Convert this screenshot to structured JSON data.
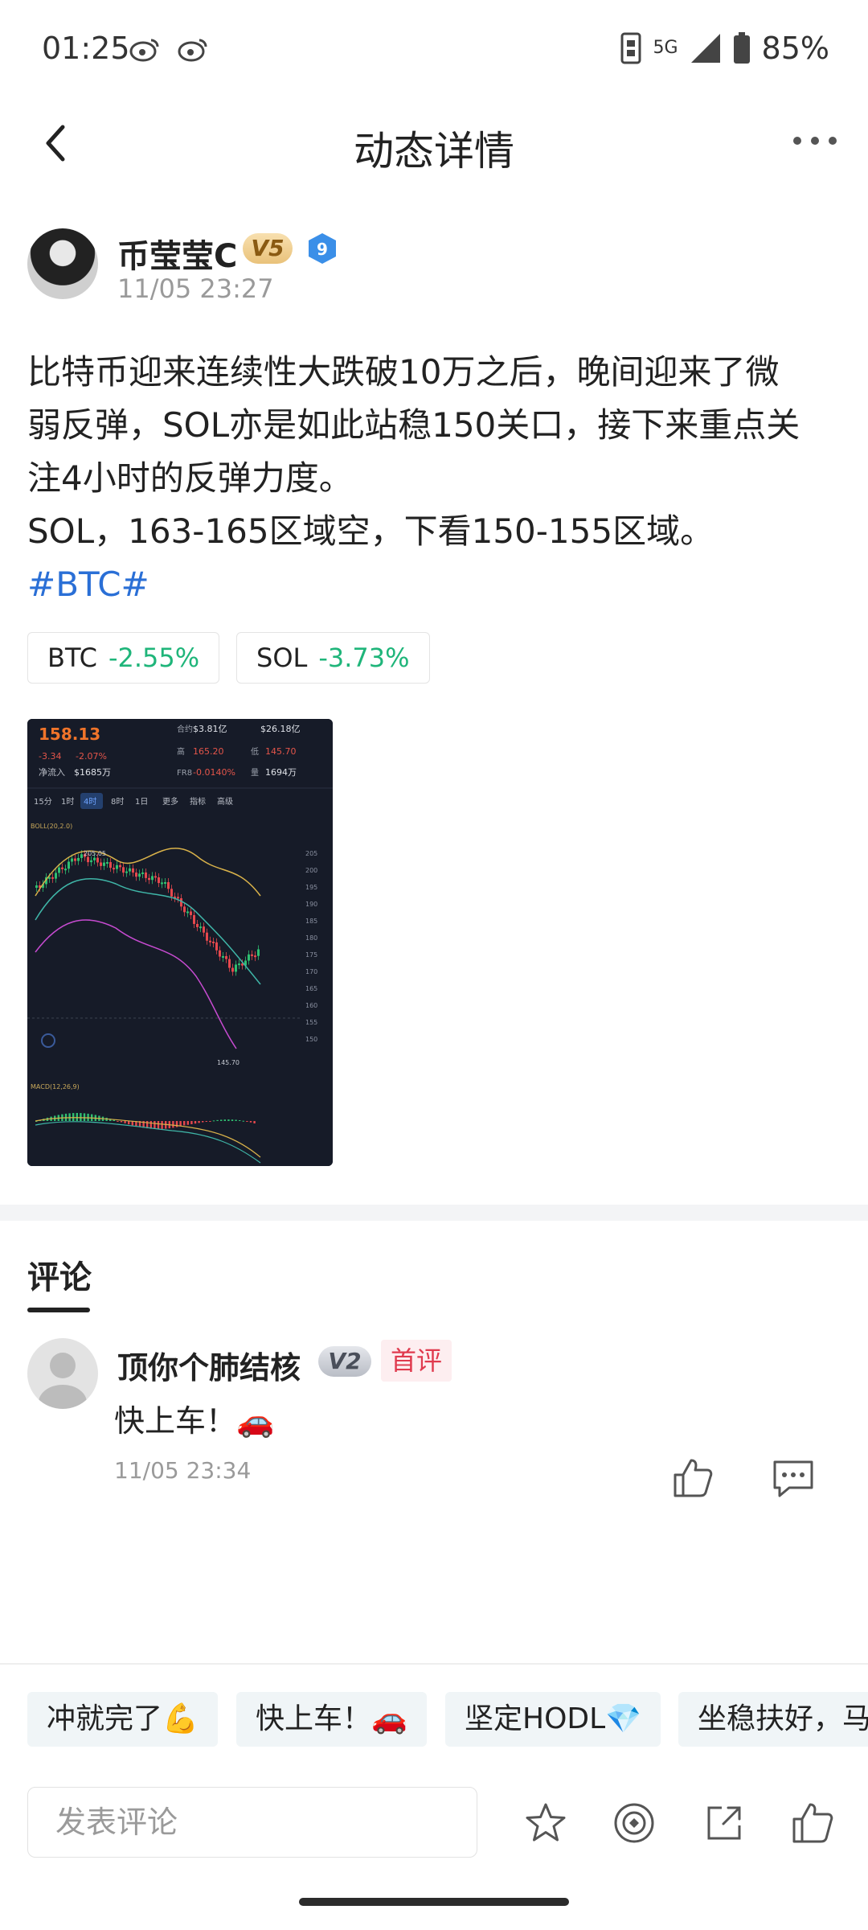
{
  "status_bar": {
    "time": "01:25",
    "battery": "85%",
    "network": "5G"
  },
  "header": {
    "title": "动态详情"
  },
  "post": {
    "author": "币莹莹C",
    "author_badge": "V5",
    "level_badge": "9",
    "time": "11/05 23:27",
    "text": "比特币迎来连续性大跌破10万之后，晚间迎来了微\n弱反弹，SOL亦是如此站稳150关口，接下来重点关\n注4小时的反弹力度。\nSOL，163-165区域空，下看150-155区域。",
    "hashtag": "#BTC#",
    "tickers": [
      {
        "symbol": "BTC",
        "change": "-2.55%"
      },
      {
        "symbol": "SOL",
        "change": "-3.73%"
      }
    ]
  },
  "chart_image": {
    "price": "158.13",
    "delta": "-3.34",
    "delta_pct": "-2.07%",
    "net_inflow_label": "净流入",
    "net_inflow": "$1685万",
    "turnover_label": "合约",
    "turnover": "$3.81亿",
    "volume": "$26.18亿",
    "high_label": "高",
    "high": "165.20",
    "low_label": "低",
    "low": "145.70",
    "funding_label": "FR8",
    "funding": "-0.0140%",
    "qty_label": "量",
    "qty": "1694万",
    "intervals": [
      "15分",
      "1时",
      "4时",
      "8时",
      "1日",
      "更多",
      "指标",
      "高级"
    ],
    "boll_label": "BOLL(20,2.0)",
    "macd_label": "MACD(12,26,9)",
    "y_ticks": [
      "205",
      "200",
      "195",
      "190",
      "185",
      "180",
      "175",
      "170",
      "165",
      "160",
      "155",
      "150"
    ],
    "low_mark": "145.70",
    "high_mark": "205.05"
  },
  "comments": {
    "tab_label": "评论",
    "items": [
      {
        "user": "顶你个肺结核",
        "badge": "V2",
        "tag": "首评",
        "text": "快上车！🚗",
        "time": "11/05 23:34"
      }
    ]
  },
  "quick_replies": [
    "冲就完了💪",
    "快上车！🚗",
    "坚定HODL💎",
    "坐稳扶好，马"
  ],
  "bottom_bar": {
    "input_placeholder": "发表评论"
  },
  "colors": {
    "up_green": "#1fb57a",
    "link_blue": "#2a6fd6",
    "tag_red": "#e03a4e"
  }
}
